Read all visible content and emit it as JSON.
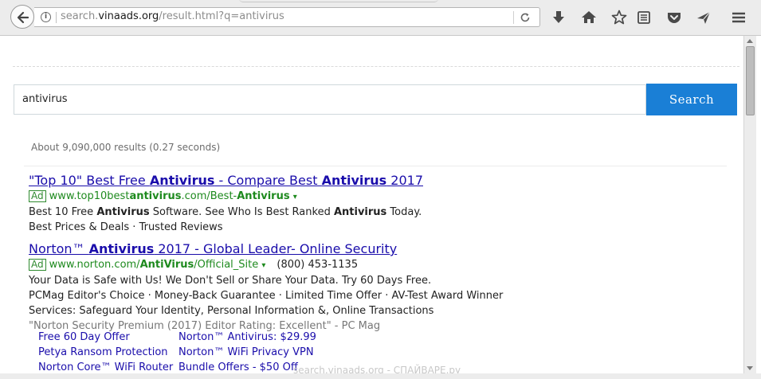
{
  "browser": {
    "url_prefix": "search.",
    "url_domain": "vinaads.org",
    "url_path": "/result.html?q=antivirus",
    "info_icon": "i",
    "icons": {
      "back": "back-arrow-icon",
      "info": "info-icon",
      "reload": "reload-icon",
      "download": "download-icon",
      "home": "home-icon",
      "bookmark": "star-icon",
      "reader": "reading-list-icon",
      "pocket": "pocket-icon",
      "send": "send-tab-icon",
      "menu": "hamburger-menu-icon"
    }
  },
  "search": {
    "query": "antivirus",
    "button_label": "Search",
    "stats": "About 9,090,000 results (0.27 seconds)"
  },
  "ads": [
    {
      "title_parts": [
        "\"Top 10\" Best Free ",
        "Antivirus",
        " - Compare Best ",
        "Antivirus",
        " 2017"
      ],
      "badge": "Ad",
      "url_parts": [
        "www.top10best",
        "antivirus",
        ".com/Best-",
        "Antivirus"
      ],
      "caret": "▾",
      "desc1_parts": [
        "Best 10 Free ",
        "Antivirus",
        " Software. See Who Is Best Ranked ",
        "Antivirus",
        " Today."
      ],
      "desc2": "Best Prices & Deals · Trusted Reviews"
    },
    {
      "title_parts": [
        "Norton™ ",
        "Antivirus",
        " 2017 - Global Leader- Online Security"
      ],
      "badge": "Ad",
      "url_parts": [
        "www.norton.com/",
        "AntiVirus",
        "/Official_Site"
      ],
      "caret": "▾",
      "phone": "(800) 453-1135",
      "lines": [
        "Your Data is Safe with Us! We Don't Sell or Share Your Data. Try 60 Days Free.",
        "PCMag Editor's Choice · Money-Back Guarantee · Limited Time Offer · AV-Test Award Winner",
        "Services: Safeguard Your Identity, Personal Information &, Online Transactions"
      ],
      "quote": "\"Norton Security Premium (2017) Editor Rating: Excellent\" - PC Mag",
      "sitelinks": [
        "Free 60 Day Offer",
        "Norton™ Antivirus: $29.99",
        "Petya Ransom Protection",
        "Norton™ WiFi Privacy VPN",
        "Norton Core™ WiFi Router",
        "Bundle Offers - $50 Off"
      ]
    }
  ],
  "watermark": "search.vinaads.org - СПАЙВАРЕ.ру",
  "colors": {
    "link": "#1a0dab",
    "ad_url": "#1e8a1e",
    "search_button": "#1a7fd6"
  }
}
